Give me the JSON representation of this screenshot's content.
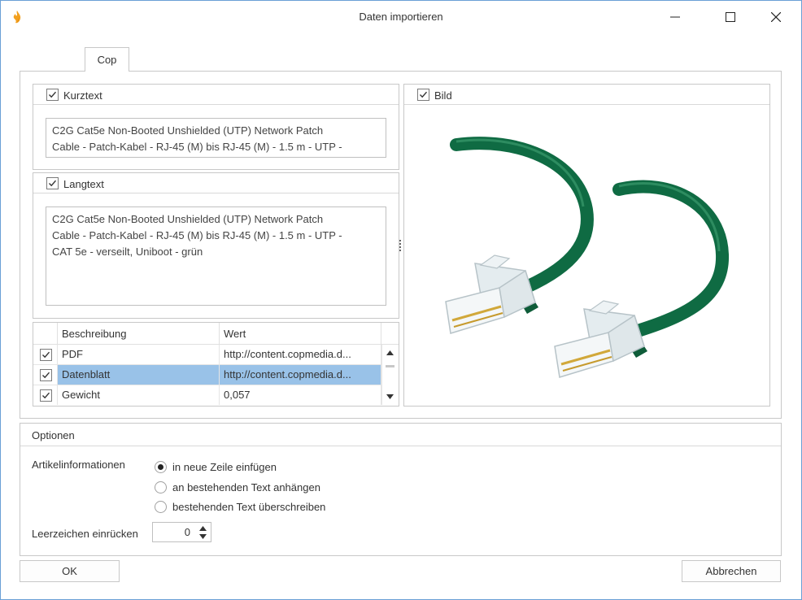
{
  "window": {
    "title": "Daten importieren",
    "colors": {
      "border": "#6a9fd6",
      "selection": "#99c2e8",
      "app_icon": "#f2a01e"
    }
  },
  "tabs": [
    {
      "label": "Cop",
      "selected": true
    }
  ],
  "kurztext": {
    "label": "Kurztext",
    "checked": true,
    "value": "C2G Cat5e Non-Booted Unshielded (UTP) Network Patch\nCable - Patch-Kabel - RJ-45 (M) bis RJ-45 (M) - 1.5 m - UTP -"
  },
  "langtext": {
    "label": "Langtext",
    "checked": true,
    "value": "C2G Cat5e Non-Booted Unshielded (UTP) Network Patch\nCable - Patch-Kabel - RJ-45 (M) bis RJ-45 (M) - 1.5 m - UTP -\nCAT 5e - verseilt, Uniboot - grün"
  },
  "bild": {
    "label": "Bild",
    "checked": true
  },
  "grid": {
    "columns": [
      "Beschreibung",
      "Wert"
    ],
    "rows": [
      {
        "checked": true,
        "beschreibung": "PDF",
        "wert": "http://content.copmedia.d...",
        "selected": false
      },
      {
        "checked": true,
        "beschreibung": "Datenblatt",
        "wert": "http://content.copmedia.d...",
        "selected": true
      },
      {
        "checked": true,
        "beschreibung": "Gewicht",
        "wert": "0,057",
        "selected": false
      }
    ]
  },
  "options": {
    "title": "Optionen",
    "artikel_label": "Artikelinformationen",
    "radios": [
      {
        "label": "in neue Zeile einfügen",
        "checked": true
      },
      {
        "label": "an bestehenden Text anhängen",
        "checked": false
      },
      {
        "label": "bestehenden Text überschreiben",
        "checked": false
      }
    ],
    "indent_label": "Leerzeichen einrücken",
    "indent_value": "0"
  },
  "buttons": {
    "ok": "OK",
    "cancel": "Abbrechen"
  }
}
